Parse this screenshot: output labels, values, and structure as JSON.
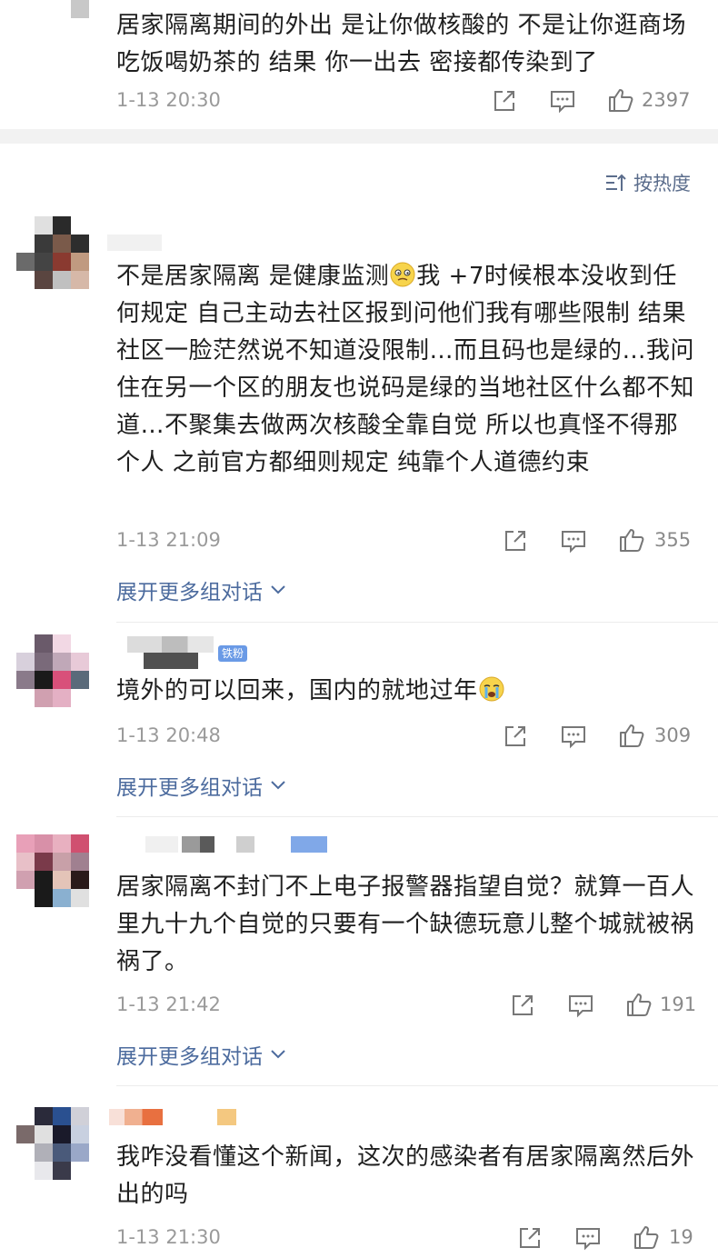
{
  "comments": [
    {
      "text": "居家隔离期间的外出 是让你做核酸的 不是让你逛商场吃饭喝奶茶的 结果 你一出去 密接都传染到了",
      "time": "1-13 20:30",
      "likes": "2397"
    },
    {
      "text_before_emoji": "不是居家隔离 是健康监测",
      "emoji": "smirk-face",
      "text_after_emoji": "我 +7时候根本没收到任何规定 自己主动去社区报到问他们我有哪些限制 结果社区一脸茫然说不知道没限制…而且码也是绿的…我问住在另一个区的朋友也说码是绿的当地社区什么都不知道…不聚集去做两次核酸全靠自觉 所以也真怪不得那个人 之前官方都细则规定 纯靠个人道德约束",
      "time": "1-13 21:09",
      "likes": "355",
      "expand": "展开更多组对话"
    },
    {
      "badge": "铁粉",
      "text": "境外的可以回来，国内的就地过年",
      "emoji": "crying-face",
      "time": "1-13 20:48",
      "likes": "309",
      "expand": "展开更多组对话"
    },
    {
      "text": "居家隔离不封门不上电子报警器指望自觉？就算一百人里九十九个自觉的只要有一个缺德玩意儿整个城就被祸祸了。",
      "time": "1-13 21:42",
      "likes": "191",
      "expand": "展开更多组对话"
    },
    {
      "text": "我咋没看懂这个新闻，这次的感染者有居家隔离然后外出的吗",
      "time": "1-13 21:30",
      "likes": "19"
    }
  ],
  "sort": {
    "label": "按热度",
    "icon": "sort-icon"
  },
  "icons": {
    "share": "share-icon",
    "comment": "comment-icon",
    "like": "thumbs-up-icon",
    "chevron": "chevron-down-icon"
  },
  "colors": {
    "link": "#4c6b9e",
    "meta": "#9a9a9a",
    "badge": "#6a9ae6"
  }
}
